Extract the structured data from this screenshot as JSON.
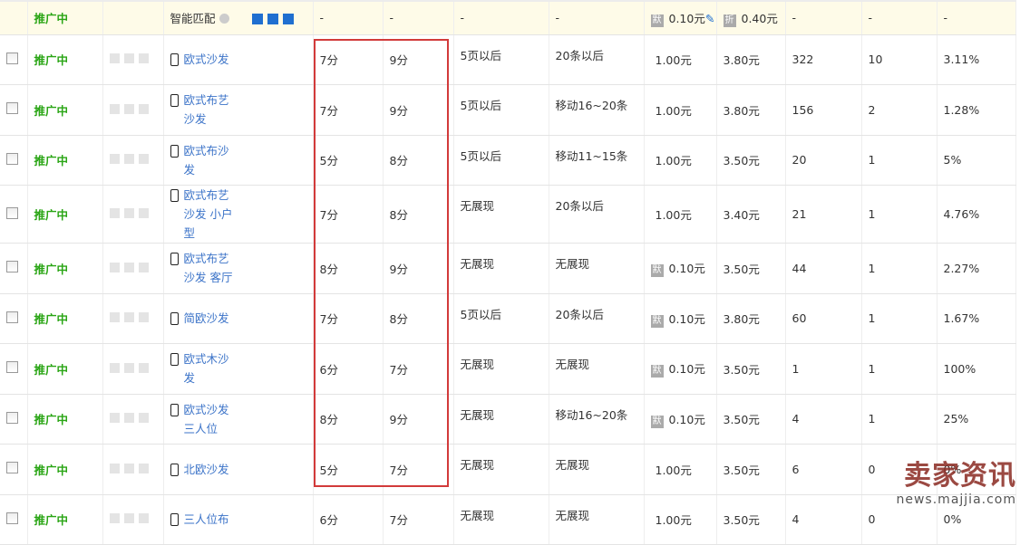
{
  "header_row": {
    "status": "推广中",
    "match": "智能匹配",
    "scores": [
      "-",
      "-"
    ],
    "ranks": [
      "-",
      "-"
    ],
    "bid_pc_badge": "默",
    "bid_pc": "0.10元",
    "bid_mobile_badge": "折",
    "bid_mobile": "0.40元",
    "stats": [
      "-",
      "-",
      "-"
    ]
  },
  "rows": [
    {
      "status": "推广中",
      "keyword": "欧式沙发",
      "s1": "7分",
      "s2": "9分",
      "r1": "5页以后",
      "r2": "20条以后",
      "badge": "",
      "b1": "1.00元",
      "b2": "3.80元",
      "n1": "322",
      "n2": "10",
      "pct": "3.11%"
    },
    {
      "status": "推广中",
      "keyword": "欧式布艺沙发",
      "s1": "7分",
      "s2": "9分",
      "r1": "5页以后",
      "r2": "移动16~20条",
      "badge": "",
      "b1": "1.00元",
      "b2": "3.80元",
      "n1": "156",
      "n2": "2",
      "pct": "1.28%"
    },
    {
      "status": "推广中",
      "keyword": "欧式布沙发",
      "s1": "5分",
      "s2": "8分",
      "r1": "5页以后",
      "r2": "移动11~15条",
      "badge": "",
      "b1": "1.00元",
      "b2": "3.50元",
      "n1": "20",
      "n2": "1",
      "pct": "5%"
    },
    {
      "status": "推广中",
      "keyword": "欧式布艺沙发 小户型",
      "s1": "7分",
      "s2": "8分",
      "r1": "无展现",
      "r2": "20条以后",
      "badge": "",
      "b1": "1.00元",
      "b2": "3.40元",
      "n1": "21",
      "n2": "1",
      "pct": "4.76%"
    },
    {
      "status": "推广中",
      "keyword": "欧式布艺沙发 客厅",
      "s1": "8分",
      "s2": "9分",
      "r1": "无展现",
      "r2": "无展现",
      "badge": "默",
      "b1": "0.10元",
      "b2": "3.50元",
      "n1": "44",
      "n2": "1",
      "pct": "2.27%"
    },
    {
      "status": "推广中",
      "keyword": "简欧沙发",
      "s1": "7分",
      "s2": "8分",
      "r1": "5页以后",
      "r2": "20条以后",
      "badge": "默",
      "b1": "0.10元",
      "b2": "3.80元",
      "n1": "60",
      "n2": "1",
      "pct": "1.67%"
    },
    {
      "status": "推广中",
      "keyword": "欧式木沙发",
      "s1": "6分",
      "s2": "7分",
      "r1": "无展现",
      "r2": "无展现",
      "badge": "默",
      "b1": "0.10元",
      "b2": "3.50元",
      "n1": "1",
      "n2": "1",
      "pct": "100%"
    },
    {
      "status": "推广中",
      "keyword": "欧式沙发三人位",
      "s1": "8分",
      "s2": "9分",
      "r1": "无展现",
      "r2": "移动16~20条",
      "badge": "默",
      "b1": "0.10元",
      "b2": "3.50元",
      "n1": "4",
      "n2": "1",
      "pct": "25%"
    },
    {
      "status": "推广中",
      "keyword": "北欧沙发",
      "s1": "5分",
      "s2": "7分",
      "r1": "无展现",
      "r2": "无展现",
      "badge": "",
      "b1": "1.00元",
      "b2": "3.50元",
      "n1": "6",
      "n2": "0",
      "pct": "0%"
    },
    {
      "status": "推广中",
      "keyword": "三人位布",
      "s1": "6分",
      "s2": "7分",
      "r1": "无展现",
      "r2": "无展现",
      "badge": "",
      "b1": "1.00元",
      "b2": "3.50元",
      "n1": "4",
      "n2": "0",
      "pct": "0%"
    }
  ],
  "watermark": {
    "title": "卖家资讯",
    "url": "news.majjia.com"
  },
  "colors": {
    "status": "#2aa515",
    "keyword": "#3b73c8",
    "highlight": "#d23a3a"
  }
}
